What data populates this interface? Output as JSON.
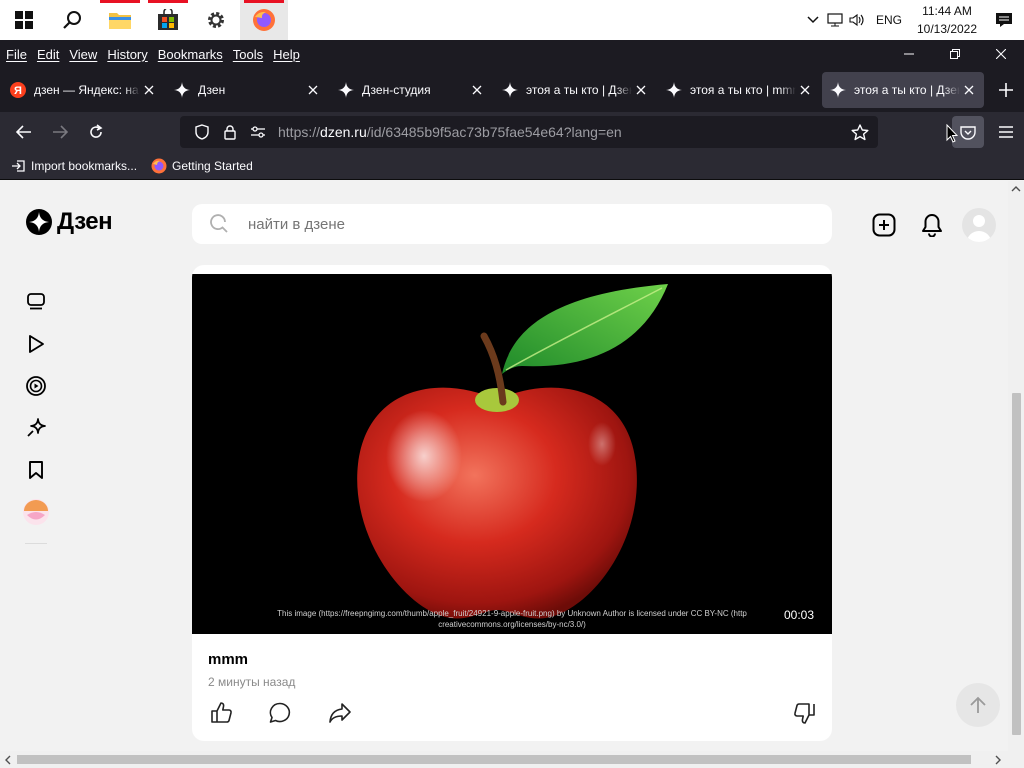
{
  "taskbar": {
    "apps": [
      {
        "name": "start-button",
        "icon": "windows-icon"
      },
      {
        "name": "search-button",
        "icon": "search-icon"
      },
      {
        "name": "file-explorer",
        "icon": "folder-icon"
      },
      {
        "name": "microsoft-store",
        "icon": "store-icon"
      },
      {
        "name": "settings",
        "icon": "gear-icon"
      },
      {
        "name": "firefox",
        "icon": "firefox-icon"
      }
    ],
    "language": "ENG",
    "time": "11:44 AM",
    "date": "10/13/2022"
  },
  "browser": {
    "menu": [
      "File",
      "Edit",
      "View",
      "History",
      "Bookmarks",
      "Tools",
      "Help"
    ],
    "tabs": [
      {
        "title": "дзен — Яндекс: наш",
        "favicon": "yandex-icon",
        "selected": false
      },
      {
        "title": "Дзен",
        "favicon": "dzen-icon",
        "selected": false
      },
      {
        "title": "Дзен-студия",
        "favicon": "dzen-icon",
        "selected": false
      },
      {
        "title": "этоя а ты кто | Дзен",
        "favicon": "dzen-icon",
        "selected": false
      },
      {
        "title": "этоя а ты кто | mmm",
        "favicon": "dzen-icon",
        "selected": false
      },
      {
        "title": "этоя а ты кто | Дзен",
        "favicon": "dzen-icon",
        "selected": true
      }
    ],
    "url_prefix": "https://",
    "url_host": "dzen.ru",
    "url_rest": "/id/63485b9f5ac73b75fae54e64?lang=en",
    "bookmarks": [
      {
        "label": "Import bookmarks...",
        "icon": "import-icon"
      },
      {
        "label": "Getting Started",
        "icon": "firefox-icon"
      }
    ]
  },
  "page": {
    "logo_text": "Дзен",
    "search_placeholder": "найти в дзене",
    "sidebar": [
      {
        "name": "feed",
        "icon": "feed-icon"
      },
      {
        "name": "video",
        "icon": "play-icon"
      },
      {
        "name": "shorts",
        "icon": "shorts-icon"
      },
      {
        "name": "subscriptions",
        "icon": "sparkle-icon"
      },
      {
        "name": "bookmarks",
        "icon": "bookmark-icon"
      },
      {
        "name": "channel",
        "icon": "channel-avatar"
      }
    ],
    "post": {
      "title": "mmm",
      "time_ago": "2 минуты назад",
      "video_caption_line1": "This image (https://freepngimg.com/thumb/apple_fruit/24921-9-apple-fruit.png) by Unknown Author is licensed under CC BY-NC (http",
      "video_caption_line2": "creativecommons.org/licenses/by-nc/3.0/)",
      "duration": "00:03"
    },
    "colors": {
      "firefox_dark": "#1c1b22",
      "firefox_toolbar": "#2b2a33",
      "page_bg": "#f2f2f2",
      "apple_red": "#d62a1e"
    }
  }
}
